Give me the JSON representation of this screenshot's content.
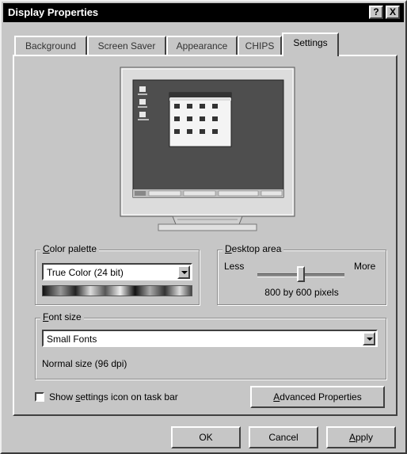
{
  "window": {
    "title": "Display Properties",
    "help_label": "?",
    "close_label": "X"
  },
  "tabs": [
    {
      "label": "Background",
      "active": false
    },
    {
      "label": "Screen Saver",
      "active": false
    },
    {
      "label": "Appearance",
      "active": false
    },
    {
      "label": "CHIPS",
      "active": false
    },
    {
      "label": "Settings",
      "active": true
    }
  ],
  "color_palette": {
    "legend": "Color palette",
    "legend_accel": "C",
    "legend_rest": "olor palette",
    "value": "True Color (24 bit)"
  },
  "desktop_area": {
    "legend_accel": "D",
    "legend_rest": "esktop area",
    "less_label": "Less",
    "more_label": "More",
    "slider_fraction": 0.5,
    "resolution_text": "800 by 600 pixels"
  },
  "font_size": {
    "legend_accel": "F",
    "legend_rest": "ont size",
    "value": "Small Fonts",
    "description": "Normal size (96 dpi)"
  },
  "taskbar_checkbox": {
    "label_pre": "Show ",
    "label_accel": "s",
    "label_post": "ettings icon on task bar",
    "checked": false
  },
  "buttons": {
    "advanced_accel": "A",
    "advanced_rest": "dvanced Properties",
    "ok_label": "OK",
    "cancel_label": "Cancel",
    "apply_accel": "A",
    "apply_rest": "pply"
  },
  "colors": {
    "desktop_teal": "#4a4a4a",
    "titlebar": "#000000",
    "face": "#c6c6c6"
  }
}
